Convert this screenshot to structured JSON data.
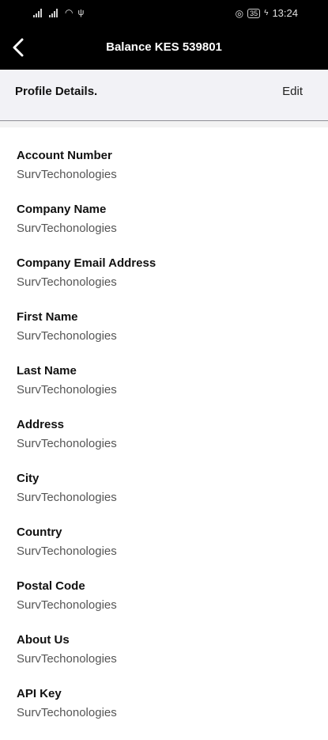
{
  "status_bar": {
    "time": "13:24",
    "battery": "35"
  },
  "header": {
    "title": "Balance KES 539801"
  },
  "profile": {
    "title": "Profile Details.",
    "edit_label": "Edit"
  },
  "fields": [
    {
      "label": "Account Number",
      "value": "SurvTechonologies"
    },
    {
      "label": "Company Name",
      "value": "SurvTechonologies"
    },
    {
      "label": "Company Email Address",
      "value": "SurvTechonologies"
    },
    {
      "label": "First Name",
      "value": "SurvTechonologies"
    },
    {
      "label": "Last Name",
      "value": "SurvTechonologies"
    },
    {
      "label": "Address",
      "value": "SurvTechonologies"
    },
    {
      "label": "City",
      "value": "SurvTechonologies"
    },
    {
      "label": "Country",
      "value": "SurvTechonologies"
    },
    {
      "label": "Postal Code",
      "value": "SurvTechonologies"
    },
    {
      "label": "About Us",
      "value": "SurvTechonologies"
    },
    {
      "label": "API Key",
      "value": "SurvTechonologies"
    }
  ]
}
